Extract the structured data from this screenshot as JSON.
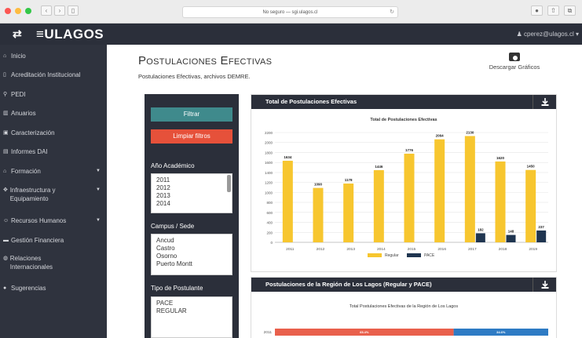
{
  "browser": {
    "url": "No seguro — sgi.ulagos.cl",
    "reload_icon": "reload-icon",
    "nav_back": "‹",
    "nav_fwd": "›",
    "sidebar_icon": "sidebar-icon",
    "right_icons": [
      "settings-icon",
      "share-icon",
      "tabs-icon"
    ]
  },
  "app": {
    "logo": "≡ULAGOS",
    "hamburger": "⇄",
    "user": "cperez@ulagos.cl"
  },
  "sidebar": {
    "items": [
      {
        "icon": "home-icon",
        "glyph": "⌂",
        "label": "Inicio"
      },
      {
        "icon": "document-icon",
        "glyph": "▯",
        "label": "Acreditación Institucional"
      },
      {
        "icon": "network-icon",
        "glyph": "⚲",
        "label": "PEDI"
      },
      {
        "icon": "chart-icon",
        "glyph": "▥",
        "label": "Anuarios"
      },
      {
        "icon": "card-icon",
        "glyph": "▣",
        "label": "Caracterización"
      },
      {
        "icon": "file-icon",
        "glyph": "▤",
        "label": "Informes DAI"
      },
      {
        "icon": "institution-icon",
        "glyph": "⌂",
        "label": "Formación"
      },
      {
        "icon": "tools-icon",
        "glyph": "✥",
        "label": "Infraestructura y Equipamiento"
      },
      {
        "icon": "users-icon",
        "glyph": "☺",
        "label": "Recursos Humanos"
      },
      {
        "icon": "money-icon",
        "glyph": "▬",
        "label": "Gestión Financiera"
      },
      {
        "icon": "globe-icon",
        "glyph": "◍",
        "label": "Relaciones Internacionales"
      },
      {
        "icon": "help-icon",
        "glyph": "●",
        "label": "Sugerencias"
      }
    ]
  },
  "page": {
    "title": "Postulaciones Efectivas",
    "subtitle": "Postulaciones Efectivas, archivos DEMRE.",
    "download_label": "Descargar Gráficos"
  },
  "filters": {
    "filter_button": "Filtrar",
    "clear_button": "Limpiar filtros",
    "year_label": "Año Académico",
    "years": [
      "2011",
      "2012",
      "2013",
      "2014"
    ],
    "campus_label": "Campus / Sede",
    "campuses": [
      "Ancud",
      "Castro",
      "Osorno",
      "Puerto Montt"
    ],
    "type_label": "Tipo de Postulante",
    "types": [
      "PACE",
      "REGULAR"
    ]
  },
  "colors": {
    "regular": "#f7c62f",
    "pace": "#1f3550",
    "filter_btn": "#3f8a8c",
    "clear_btn": "#e6513a",
    "dark": "#2b2f3a"
  },
  "cards": {
    "total_title": "Total de Postulaciones Efectivas",
    "region_title": "Postulaciones de la Región de Los Lagos (Regular y PACE)"
  },
  "chart_data": [
    {
      "type": "bar",
      "title": "Total de Postulaciones Efectivas",
      "categories": [
        "2011",
        "2012",
        "2013",
        "2014",
        "2015",
        "2016",
        "2017",
        "2018",
        "2019"
      ],
      "series": [
        {
          "name": "Regular",
          "values": [
            1634,
            1090,
            1178,
            1446,
            1776,
            2064,
            2130,
            1620,
            1450
          ]
        },
        {
          "name": "PACE",
          "values": [
            null,
            null,
            null,
            null,
            null,
            null,
            182,
            148,
            237
          ]
        }
      ],
      "y_ticks": [
        0,
        200,
        400,
        600,
        800,
        1000,
        1200,
        1400,
        1600,
        1800,
        2000,
        2200
      ],
      "ylim": [
        0,
        2200
      ],
      "legend": "bottom-center",
      "grid": true
    },
    {
      "type": "bar",
      "title": "Total Postulaciones Efectivas de la Región de Los Lagos",
      "categories": [
        "2011"
      ],
      "series": [
        {
          "name": "Regular",
          "values": [
            "65.4%"
          ]
        },
        {
          "name": "PACE",
          "values": [
            "34.6%"
          ]
        }
      ]
    }
  ]
}
